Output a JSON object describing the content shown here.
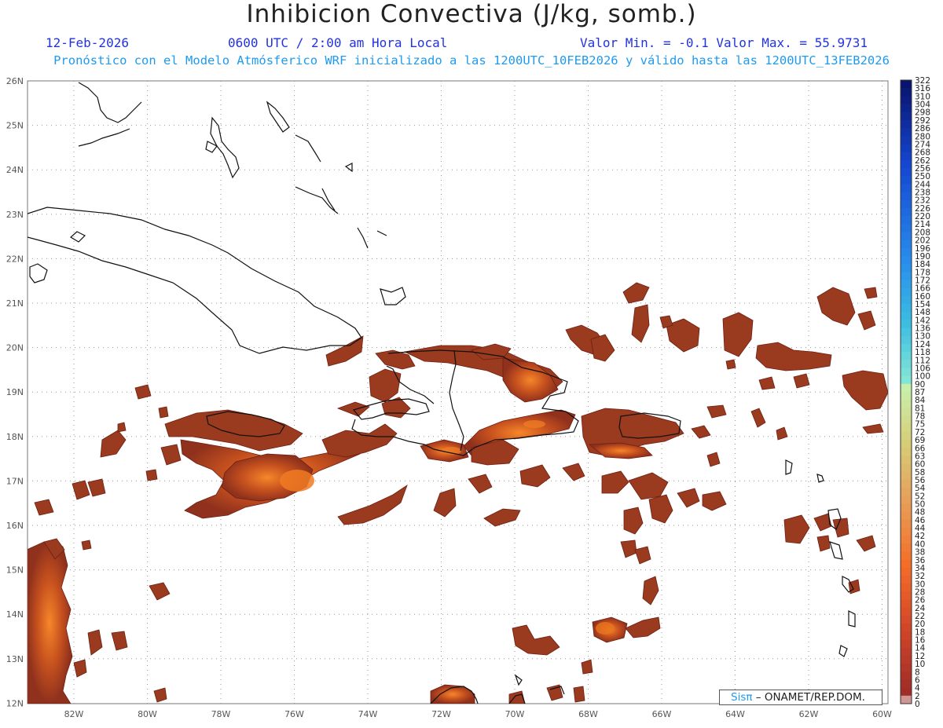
{
  "header": {
    "title": "Inhibicion Convectiva (J/kg, somb.)",
    "date": "12-Feb-2026",
    "time": "0600 UTC / 2:00 am Hora Local",
    "min_max": "Valor Min. = -0.1  Valor Max. = 55.9731",
    "subtitle": "Pronóstico con el Modelo Atmósferico WRF inicializado a las 1200UTC_10FEB2026 y válido hasta las  1200UTC_13FEB2026"
  },
  "credit": {
    "brand": "Sisπ",
    "rest": "– ONAMET/REP.DOM."
  },
  "axes": {
    "lon_labels": [
      "82W",
      "80W",
      "78W",
      "76W",
      "74W",
      "72W",
      "70W",
      "68W",
      "66W",
      "64W",
      "62W",
      "60W"
    ],
    "lat_labels": [
      "26N",
      "25N",
      "24N",
      "23N",
      "22N",
      "21N",
      "20N",
      "19N",
      "18N",
      "17N",
      "16N",
      "15N",
      "14N",
      "13N",
      "12N"
    ]
  },
  "colorbar": {
    "labels": [
      "322",
      "316",
      "310",
      "304",
      "298",
      "292",
      "286",
      "280",
      "274",
      "268",
      "262",
      "256",
      "250",
      "244",
      "238",
      "232",
      "226",
      "220",
      "214",
      "208",
      "202",
      "196",
      "190",
      "184",
      "178",
      "172",
      "166",
      "160",
      "154",
      "148",
      "142",
      "136",
      "130",
      "124",
      "118",
      "112",
      "106",
      "100",
      "90",
      "87",
      "84",
      "81",
      "78",
      "75",
      "72",
      "69",
      "66",
      "63",
      "60",
      "58",
      "56",
      "54",
      "52",
      "50",
      "48",
      "46",
      "44",
      "42",
      "40",
      "38",
      "36",
      "34",
      "32",
      "30",
      "28",
      "26",
      "24",
      "22",
      "20",
      "18",
      "16",
      "14",
      "12",
      "10",
      "8",
      "6",
      "4",
      "2",
      "0"
    ]
  },
  "colors": {
    "title": "#222222",
    "date": "#2233dd",
    "subtitle": "#1f9aee",
    "field_low": "#8b2a1c",
    "field_high": "#f06a18"
  }
}
